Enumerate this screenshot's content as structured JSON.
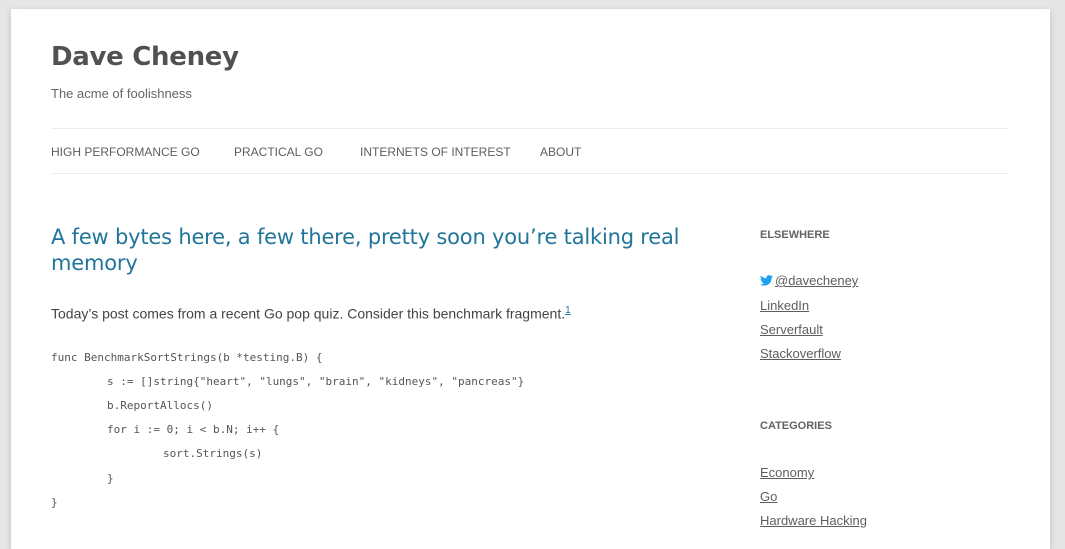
{
  "site": {
    "title": "Dave Cheney",
    "description": "The acme of foolishness"
  },
  "nav": {
    "items": [
      {
        "label": "HIGH PERFORMANCE GO"
      },
      {
        "label": "PRACTICAL GO"
      },
      {
        "label": "INTERNETS OF INTEREST"
      },
      {
        "label": "ABOUT"
      }
    ]
  },
  "post": {
    "title": "A few bytes here, a few there, pretty soon you’re talking real memory",
    "intro": "Today’s post comes from a recent Go pop quiz. Consider this benchmark fragment.",
    "footnote": "1",
    "code": [
      "func BenchmarkSortStrings(b *testing.B) {",
      "s := []string{\"heart\", \"lungs\", \"brain\", \"kidneys\", \"pancreas\"}",
      "b.ReportAllocs()",
      "for i := 0; i < b.N; i++ {",
      "sort.Strings(s)",
      "}",
      "}"
    ]
  },
  "sidebar": {
    "elsewhere": {
      "title": "ELSEWHERE",
      "links": [
        "@davecheney",
        "LinkedIn",
        "Serverfault",
        "Stackoverflow"
      ]
    },
    "categories": {
      "title": "CATEGORIES",
      "links": [
        "Economy",
        "Go",
        "Hardware Hacking"
      ]
    }
  },
  "colors": {
    "link_blue": "#21759b",
    "twitter_blue": "#1da1f2",
    "text": "#444444",
    "background": "#e6e6e6"
  }
}
